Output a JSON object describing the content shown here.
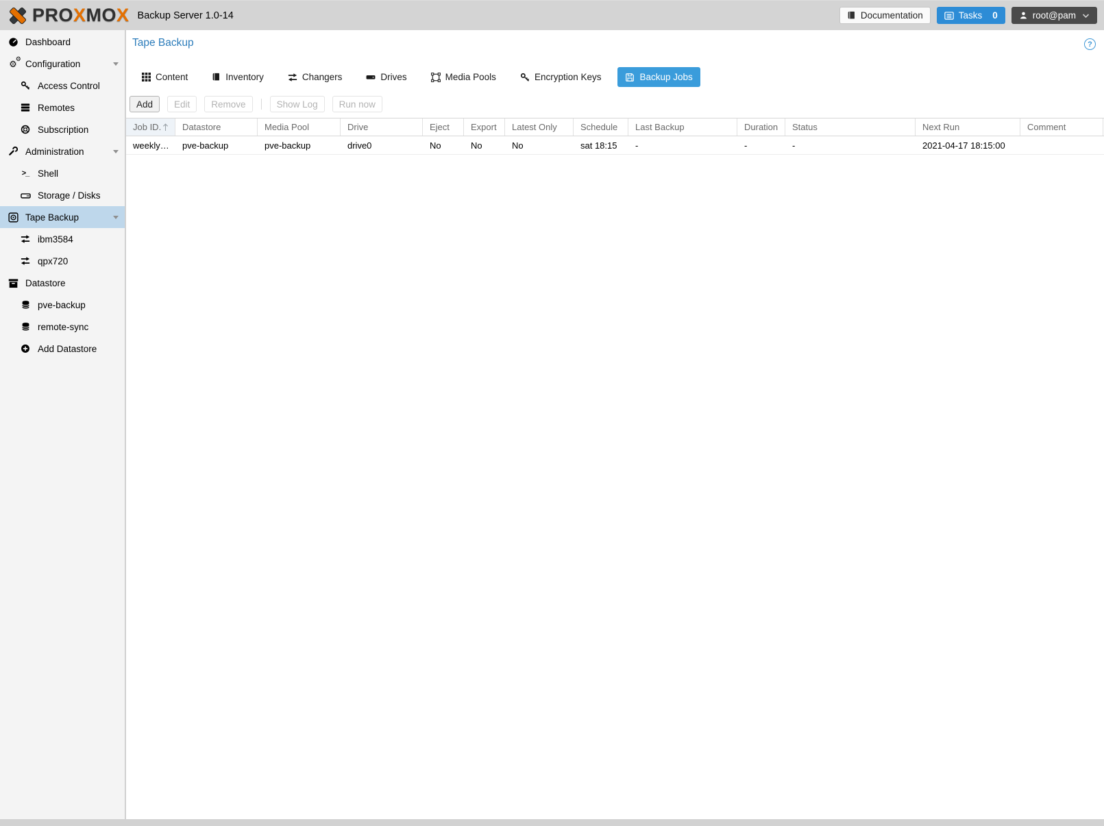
{
  "app": {
    "brand": {
      "seg1": "PRO",
      "seg2": "X",
      "seg3": "MO",
      "seg4": "X"
    },
    "product": "Backup Server 1.0-14"
  },
  "header": {
    "documentation": "Documentation",
    "tasks": "Tasks",
    "tasks_count": "0",
    "user": "root@pam"
  },
  "sidebar": {
    "items": [
      {
        "label": "Dashboard"
      },
      {
        "label": "Configuration"
      },
      {
        "label": "Access Control"
      },
      {
        "label": "Remotes"
      },
      {
        "label": "Subscription"
      },
      {
        "label": "Administration"
      },
      {
        "label": "Shell"
      },
      {
        "label": "Storage / Disks"
      },
      {
        "label": "Tape Backup"
      },
      {
        "label": "ibm3584"
      },
      {
        "label": "qpx720"
      },
      {
        "label": "Datastore"
      },
      {
        "label": "pve-backup"
      },
      {
        "label": "remote-sync"
      },
      {
        "label": "Add Datastore"
      }
    ]
  },
  "main": {
    "title": "Tape Backup",
    "help": "?",
    "tabs": [
      {
        "label": "Content"
      },
      {
        "label": "Inventory"
      },
      {
        "label": "Changers"
      },
      {
        "label": "Drives"
      },
      {
        "label": "Media Pools"
      },
      {
        "label": "Encryption Keys"
      },
      {
        "label": "Backup Jobs"
      }
    ],
    "toolbar": {
      "add": "Add",
      "edit": "Edit",
      "remove": "Remove",
      "show_log": "Show Log",
      "run_now": "Run now"
    },
    "table": {
      "columns": [
        {
          "label": "Job ID."
        },
        {
          "label": "Datastore"
        },
        {
          "label": "Media Pool"
        },
        {
          "label": "Drive"
        },
        {
          "label": "Eject"
        },
        {
          "label": "Export"
        },
        {
          "label": "Latest Only"
        },
        {
          "label": "Schedule"
        },
        {
          "label": "Last Backup"
        },
        {
          "label": "Duration"
        },
        {
          "label": "Status"
        },
        {
          "label": "Next Run"
        },
        {
          "label": "Comment"
        }
      ],
      "rows": [
        {
          "job_id": "weekly…",
          "datastore": "pve-backup",
          "media_pool": "pve-backup",
          "drive": "drive0",
          "eject": "No",
          "export": "No",
          "latest_only": "No",
          "schedule": "sat 18:15",
          "last_backup": "-",
          "duration": "-",
          "status": "-",
          "next_run": "2021-04-17 18:15:00",
          "comment": ""
        }
      ]
    }
  },
  "colors": {
    "accent_blue": "#3a9cdb",
    "title_blue": "#2d7dbb",
    "proxmox_orange": "#e57000",
    "selected_nav_bg": "#bed7eb"
  }
}
